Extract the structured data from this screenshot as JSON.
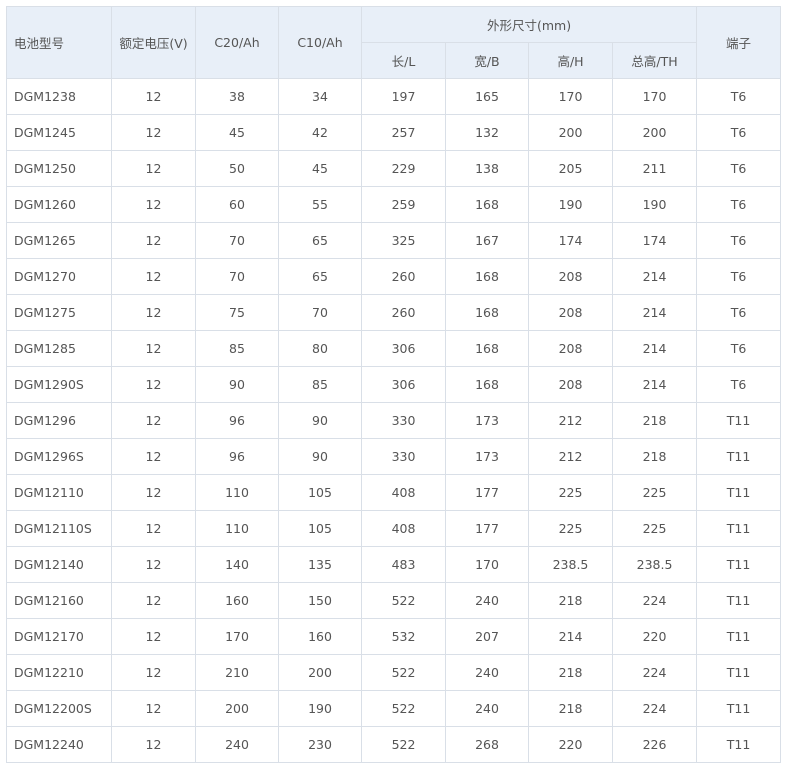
{
  "header": {
    "model": "电池型号",
    "voltage": "额定电压(V)",
    "c20": "C20/Ah",
    "c10": "C10/Ah",
    "dimensions": "外形尺寸(mm)",
    "length": "长/L",
    "width": "宽/B",
    "height": "高/H",
    "total_height": "总高/TH",
    "terminal": "端子"
  },
  "rows": [
    [
      "DGM1238",
      "12",
      "38",
      "34",
      "197",
      "165",
      "170",
      "170",
      "T6"
    ],
    [
      "DGM1245",
      "12",
      "45",
      "42",
      "257",
      "132",
      "200",
      "200",
      "T6"
    ],
    [
      "DGM1250",
      "12",
      "50",
      "45",
      "229",
      "138",
      "205",
      "211",
      "T6"
    ],
    [
      "DGM1260",
      "12",
      "60",
      "55",
      "259",
      "168",
      "190",
      "190",
      "T6"
    ],
    [
      "DGM1265",
      "12",
      "70",
      "65",
      "325",
      "167",
      "174",
      "174",
      "T6"
    ],
    [
      "DGM1270",
      "12",
      "70",
      "65",
      "260",
      "168",
      "208",
      "214",
      "T6"
    ],
    [
      "DGM1275",
      "12",
      "75",
      "70",
      "260",
      "168",
      "208",
      "214",
      "T6"
    ],
    [
      "DGM1285",
      "12",
      "85",
      "80",
      "306",
      "168",
      "208",
      "214",
      "T6"
    ],
    [
      "DGM1290S",
      "12",
      "90",
      "85",
      "306",
      "168",
      "208",
      "214",
      "T6"
    ],
    [
      "DGM1296",
      "12",
      "96",
      "90",
      "330",
      "173",
      "212",
      "218",
      "T11"
    ],
    [
      "DGM1296S",
      "12",
      "96",
      "90",
      "330",
      "173",
      "212",
      "218",
      "T11"
    ],
    [
      "DGM12110",
      "12",
      "110",
      "105",
      "408",
      "177",
      "225",
      "225",
      "T11"
    ],
    [
      "DGM12110S",
      "12",
      "110",
      "105",
      "408",
      "177",
      "225",
      "225",
      "T11"
    ],
    [
      "DGM12140",
      "12",
      "140",
      "135",
      "483",
      "170",
      "238.5",
      "238.5",
      "T11"
    ],
    [
      "DGM12160",
      "12",
      "160",
      "150",
      "522",
      "240",
      "218",
      "224",
      "T11"
    ],
    [
      "DGM12170",
      "12",
      "170",
      "160",
      "532",
      "207",
      "214",
      "220",
      "T11"
    ],
    [
      "DGM12210",
      "12",
      "210",
      "200",
      "522",
      "240",
      "218",
      "224",
      "T11"
    ],
    [
      "DGM12200S",
      "12",
      "200",
      "190",
      "522",
      "240",
      "218",
      "224",
      "T11"
    ],
    [
      "DGM12240",
      "12",
      "240",
      "230",
      "522",
      "268",
      "220",
      "226",
      "T11"
    ]
  ],
  "colors": {
    "header_bg": "#e8eff8",
    "border": "#d9dfe7",
    "text": "#555555"
  }
}
